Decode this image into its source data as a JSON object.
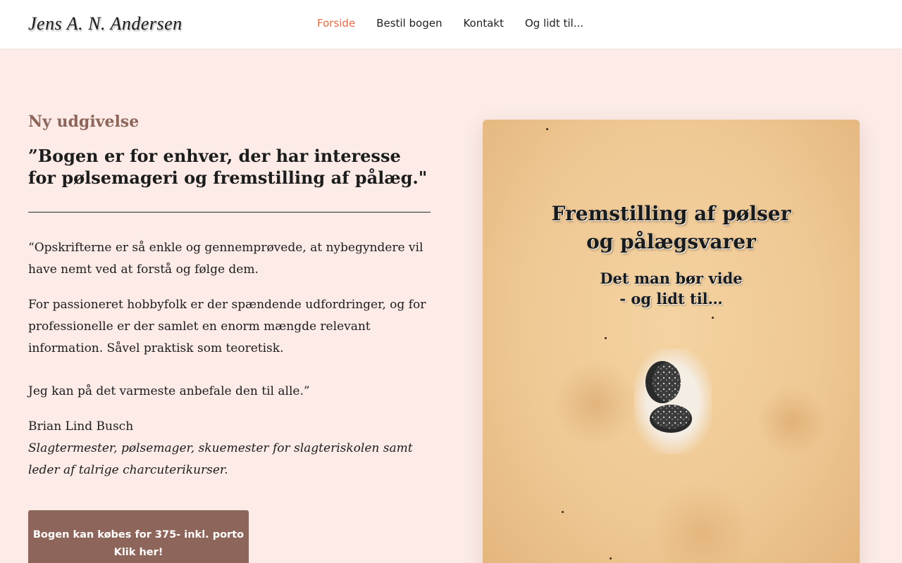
{
  "site": {
    "logo_text": "Jens A. N. Andersen"
  },
  "nav": {
    "items": [
      {
        "label": "Forside",
        "active": true
      },
      {
        "label": "Bestil bogen",
        "active": false
      },
      {
        "label": "Kontakt",
        "active": false
      },
      {
        "label": "Og lidt til...",
        "active": false
      }
    ]
  },
  "main": {
    "eyebrow": "Ny udgivelse",
    "headline": "”Bogen er for enhver, der har interesse for pølsemageri og fremstilling af pålæg.\"",
    "paragraphs": [
      "“Opskrifterne er så enkle og gennemprøvede, at nybegyndere vil have nemt ved at forstå og følge dem.",
      "For passioneret hobbyfolk er der spændende udfordringer, og for professionelle er der samlet en enorm mængde relevant information. Såvel praktisk som teoretisk.",
      "Jeg kan på det varmeste anbefale den til alle.”"
    ],
    "author_name": "Brian Lind Busch",
    "author_role": "Slagtermester, pølsemager, skuemester for slagteriskolen samt leder af talrige charcuterikurser.",
    "cta_line1": "Bogen kan købes for 375- inkl. porto",
    "cta_line2": "Klik her!"
  },
  "book_cover": {
    "title_line1": "Fremstilling af pølser",
    "title_line2": "og pålægsvarer",
    "subtitle_line1": "Det man bør vide",
    "subtitle_line2": "- og lidt til…"
  },
  "colors": {
    "accent": "#8d655a",
    "nav_active": "#e06a45",
    "page_background": "#fcebe7"
  }
}
